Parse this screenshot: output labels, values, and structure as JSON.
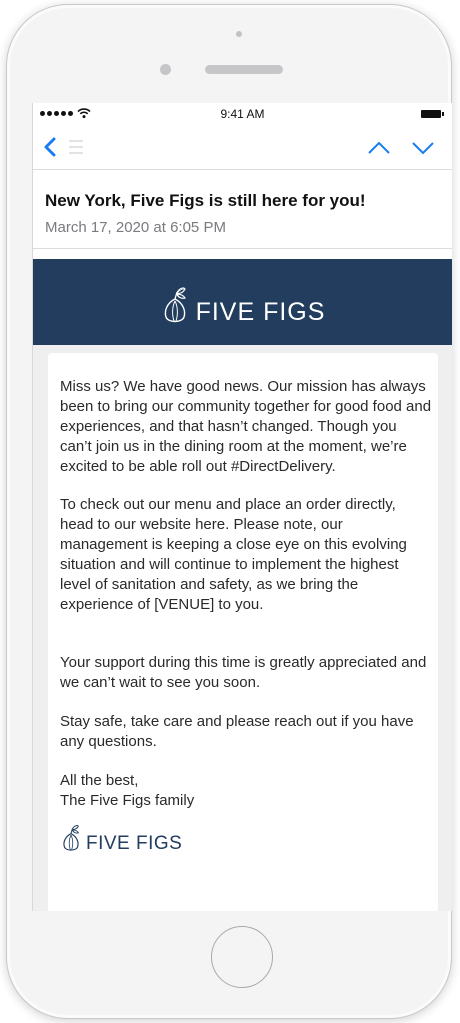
{
  "status_bar": {
    "time": "9:41 AM"
  },
  "email": {
    "subject": "New York, Five Figs is still here for you!",
    "date": "March 17, 2020 at 6:05 PM"
  },
  "brand": {
    "name": "FIVE FIGS"
  },
  "body": {
    "paragraphs": [
      "Miss us? We have good news. Our mission has always been to bring our community together for good food and experiences, and that hasn’t changed. Though you can’t join us in the dining room at the moment, we’re excited to be able roll out #DirectDelivery.",
      "To check out our menu and place an order directly, head to our website here. Please note, our management is keeping a close eye on this evolving situation and will continue to implement the highest level of sanitation and safety, as we bring the experience of [VENUE] to you.",
      "Your support during this time is greatly appreciated and we can’t wait to see you soon.",
      "Stay safe, take care and please reach out if you have any questions."
    ],
    "signoff": [
      "All the best,",
      "The Five Figs family"
    ]
  },
  "colors": {
    "brand_navy": "#223d5e",
    "ios_blue": "#1a7cf3"
  },
  "icons": [
    "back-icon",
    "inbox-icon",
    "up-arrow-icon",
    "down-arrow-icon",
    "fig-logo-icon",
    "wifi-icon",
    "battery-icon"
  ]
}
